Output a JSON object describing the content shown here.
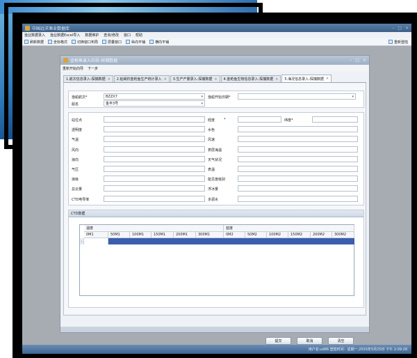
{
  "app": {
    "title": "中国远洋渔业数据库",
    "window_controls": [
      "–",
      "□",
      "×"
    ]
  },
  "menubar": [
    "渔业数据录入",
    "渔业数据Excel导入",
    "数据维护",
    "查询/修改",
    "窗口",
    "帮助"
  ],
  "toolbar": {
    "items": [
      {
        "label": "刷新数据",
        "icon": "refresh-icon"
      },
      {
        "label": "坐标格式",
        "icon": "coordinate-icon"
      },
      {
        "label": "切换窗口布局",
        "icon": "layout-icon"
      },
      {
        "label": "层叠窗口",
        "icon": "cascade-icon"
      },
      {
        "label": "纵向平铺",
        "icon": "tile-vertical-icon"
      },
      {
        "label": "横向平铺",
        "icon": "tile-horizontal-icon"
      }
    ],
    "right": {
      "label": "重新登陆",
      "icon": "user-icon"
    }
  },
  "status": "用户名:ud66   登陆时间：星期一,2015年5月25日 下午 2:09:28",
  "dialog": {
    "title": "金枪鱼录入向导-探捕数据",
    "menu": [
      "重新开始向导",
      "下一步"
    ],
    "tabs": [
      {
        "label": "1.航次信息录入-探捕数据"
      },
      {
        "label": "2.延绳钓金枪鱼生产统计录入"
      },
      {
        "label": "3.生产产量录入-探捕数据"
      },
      {
        "label": "4.金枪鱼生物信息录入-探捕数据"
      },
      {
        "label": "5.海况信息录入-探捕数据",
        "active": true
      }
    ],
    "tab_close": "×",
    "header_fields": {
      "voyage_label": "渔船航次",
      "voyage_value": "BZZX7",
      "start_date_label": "渔船开始日期",
      "ship_label": "船名",
      "ship_value": "金丰3号",
      "required_mark": "*"
    },
    "fields_left": [
      "站位点",
      "透明度",
      "气温",
      "风向",
      "浪向",
      "气压",
      "浪级",
      "总云量",
      "CTD电导率"
    ],
    "fields_right": [
      "经度",
      "水色",
      "风速",
      "表层海温",
      "天气状况",
      "表温",
      "能见度级别",
      "浮冰量",
      "多源水"
    ],
    "lat_label": "纬度",
    "ctd": {
      "section_title": "CTD数据",
      "groups": [
        {
          "label": "温度"
        },
        {
          "label": "盐度"
        }
      ],
      "columns": [
        "0M1",
        "50M1",
        "100M1",
        "150M1",
        "200M1",
        "300M1",
        "0M2",
        "50M2",
        "100M2",
        "150M2",
        "200M2",
        "300M2"
      ],
      "row_marker": "›"
    },
    "buttons": {
      "submit": "提交",
      "cancel": "取消",
      "clear": "清空"
    },
    "window_controls": [
      "–",
      "□",
      "×"
    ]
  }
}
